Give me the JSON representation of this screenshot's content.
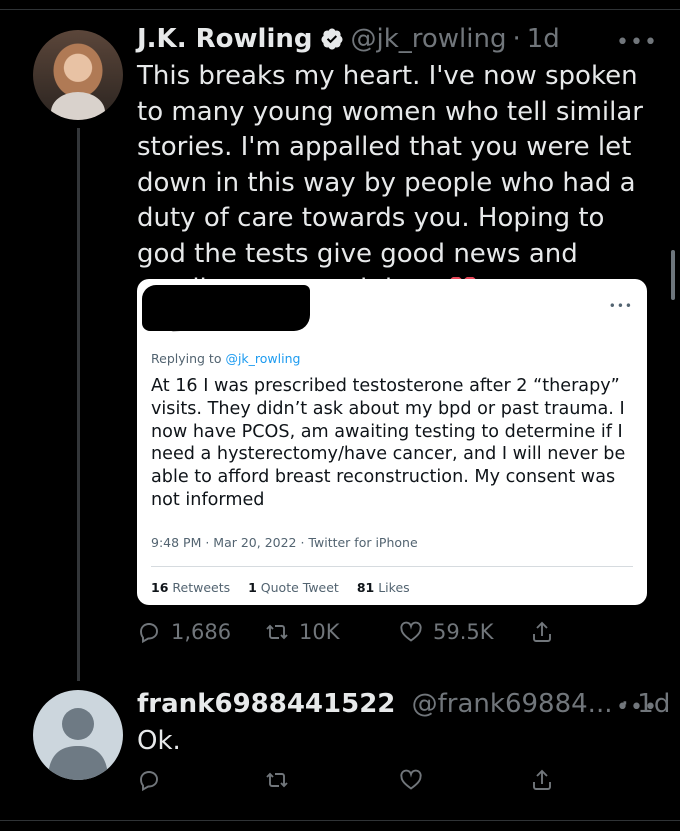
{
  "tweet": {
    "name": "J.K. Rowling",
    "handle": "@jk_rowling",
    "sep": "·",
    "time": "1d",
    "more": "•••",
    "text": "This breaks my heart. I've now spoken to many young women who tell similar stories. I'm appalled that you were let down in this way by people who had a duty of care towards you. Hoping to god the tests give good news and sending you much love",
    "quoted": {
      "more": "•••",
      "replying_prefix": "Replying to ",
      "replying_to": "@jk_rowling",
      "text": "At 16 I was prescribed testosterone after 2 “therapy” visits. They didn’t ask about my bpd or past trauma. I now have PCOS, am awaiting testing to determine if I need a hysterectomy/have cancer, and I will never be able to afford breast reconstruction. My consent was not informed",
      "meta": "9:48 PM · Mar 20, 2022 · Twitter for iPhone",
      "retweets_count": "16",
      "retweets_label": " Retweets",
      "quotes_count": "1",
      "quotes_label": " Quote Tweet",
      "likes_count": "81",
      "likes_label": " Likes"
    },
    "actions": {
      "replies": "1,686",
      "retweets": "10K",
      "likes": "59.5K"
    }
  },
  "reply": {
    "name": "frank6988441522",
    "handle": "@frank69884...",
    "sep": " · ",
    "time": "1d",
    "more": "•••",
    "text": "Ok."
  },
  "colors": {
    "background": "#000000",
    "text": "#e7e9ea",
    "muted": "#71767b",
    "link": "#1d9bf0",
    "verified": "#e7e9ea"
  },
  "icons": [
    "verified-badge-icon",
    "reply-icon",
    "retweet-icon",
    "like-icon",
    "share-icon",
    "more-icon",
    "heart-emoji-icon"
  ]
}
